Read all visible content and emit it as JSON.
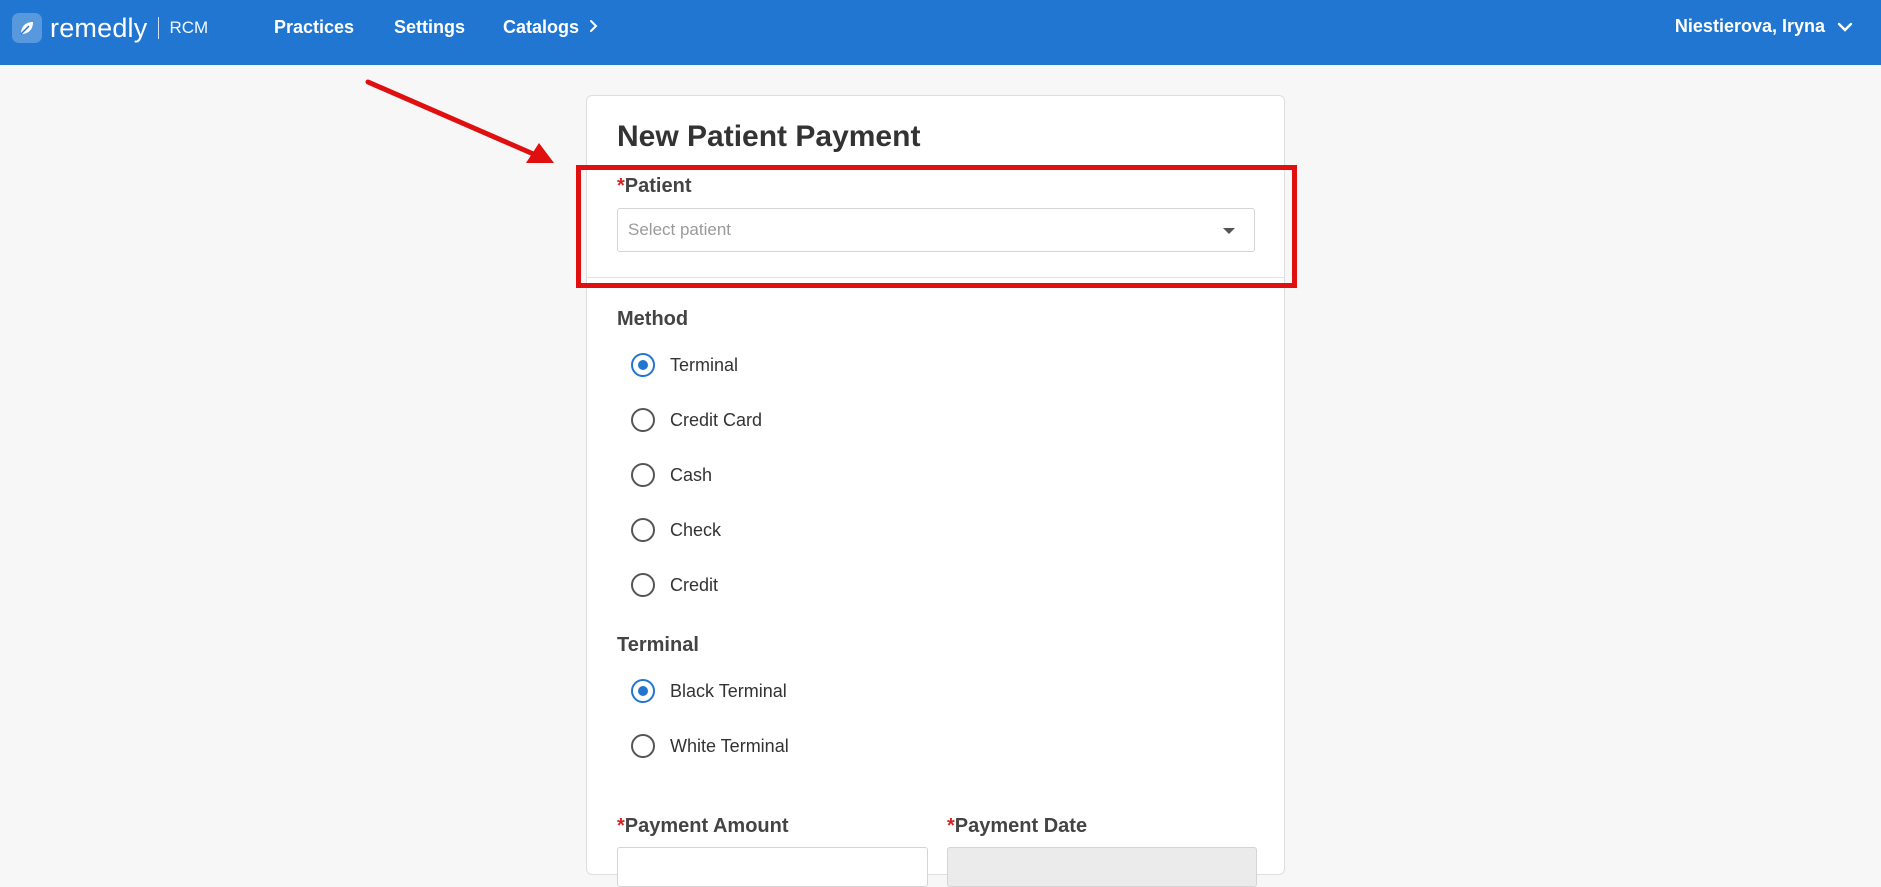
{
  "header": {
    "brand_name": "remedly",
    "brand_sub": "RCM",
    "nav": [
      {
        "label": "Practices"
      },
      {
        "label": "Settings"
      },
      {
        "label": "Catalogs"
      }
    ],
    "user_name": "Niestierova, Iryna"
  },
  "form": {
    "title": "New Patient Payment",
    "patient": {
      "label": "Patient",
      "required_mark": "*",
      "placeholder": "Select patient"
    },
    "method": {
      "label": "Method",
      "options": [
        {
          "label": "Terminal",
          "checked": true
        },
        {
          "label": "Credit Card",
          "checked": false
        },
        {
          "label": "Cash",
          "checked": false
        },
        {
          "label": "Check",
          "checked": false
        },
        {
          "label": "Credit",
          "checked": false
        }
      ]
    },
    "terminal": {
      "label": "Terminal",
      "options": [
        {
          "label": "Black Terminal",
          "checked": true
        },
        {
          "label": "White Terminal",
          "checked": false
        }
      ]
    },
    "payment_amount": {
      "label": "Payment Amount",
      "required_mark": "*"
    },
    "payment_date": {
      "label": "Payment Date",
      "required_mark": "*"
    }
  },
  "colors": {
    "header_bg": "#2176d2",
    "accent": "#2176d2",
    "required": "#d32323",
    "annotation": "#e01010"
  }
}
